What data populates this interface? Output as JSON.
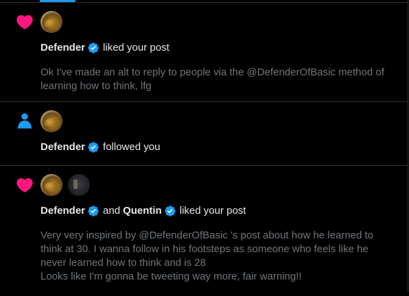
{
  "colors": {
    "background": "#000000",
    "divider": "#2f3336",
    "like_pink": "#f91880",
    "follow_blue": "#1d9bf0",
    "verified_blue": "#1d9bf0",
    "primary_text": "#e7e9ea",
    "secondary_text": "#71767b"
  },
  "notifications": [
    {
      "type_icon": "heart-icon",
      "actors": [
        {
          "name": "Defender",
          "verified": true,
          "avatar": "defender-avatar"
        }
      ],
      "action": "liked your post",
      "post_text": "Ok I've made an alt to reply to people via the @DefenderOfBasic method of learning how to think, lfg"
    },
    {
      "type_icon": "person-icon",
      "actors": [
        {
          "name": "Defender",
          "verified": true,
          "avatar": "defender-avatar"
        }
      ],
      "action": "followed you"
    },
    {
      "type_icon": "heart-icon",
      "actors": [
        {
          "name": "Defender",
          "verified": true,
          "avatar": "defender-avatar"
        },
        {
          "name": "Quentin",
          "verified": true,
          "avatar": "quentin-avatar"
        }
      ],
      "connector": "and",
      "action": "liked your post",
      "post_text": "Very very inspired by @DefenderOfBasic 's post about how he learned to think at 30. I wanna follow in his footsteps as someone who feels like he never learned how to think and is 28\nLooks like I'm gonna be tweeting way more, fair warning!!"
    }
  ]
}
